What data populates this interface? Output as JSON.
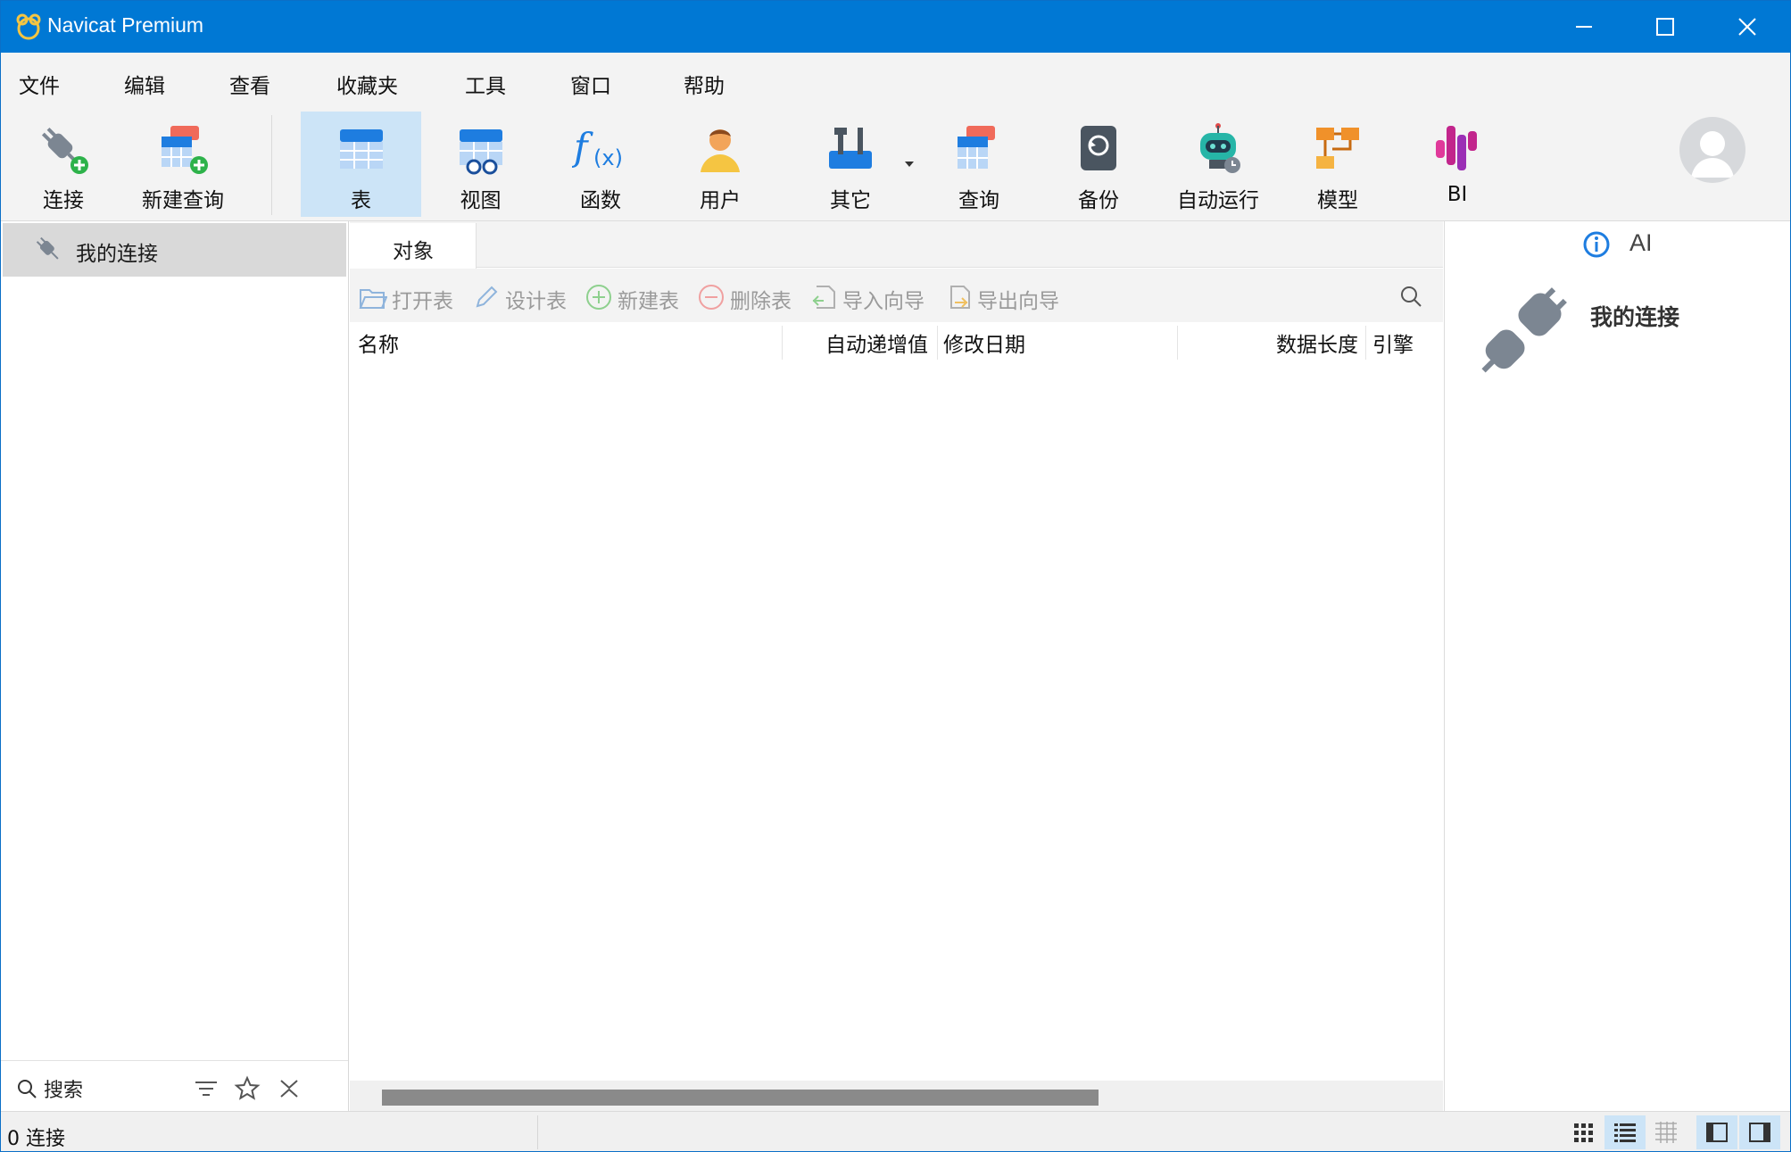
{
  "window": {
    "title": "Navicat Premium"
  },
  "menu": {
    "items": [
      "文件",
      "编辑",
      "查看",
      "收藏夹",
      "工具",
      "窗口",
      "帮助"
    ]
  },
  "toolbar": {
    "items": [
      {
        "label": "连接",
        "icon": "plug-add-icon"
      },
      {
        "label": "新建查询",
        "icon": "new-query-icon"
      },
      {
        "label": "表",
        "icon": "table-icon",
        "active": true
      },
      {
        "label": "视图",
        "icon": "view-icon"
      },
      {
        "label": "函数",
        "icon": "function-icon"
      },
      {
        "label": "用户",
        "icon": "user-icon"
      },
      {
        "label": "其它",
        "icon": "tools-icon"
      },
      {
        "label": "查询",
        "icon": "query-icon"
      },
      {
        "label": "备份",
        "icon": "backup-icon"
      },
      {
        "label": "自动运行",
        "icon": "robot-icon"
      },
      {
        "label": "模型",
        "icon": "model-icon"
      },
      {
        "label": "BI",
        "icon": "bi-icon"
      }
    ]
  },
  "left_panel": {
    "connection": "我的连接",
    "search_label": "搜索"
  },
  "center": {
    "tab": "对象",
    "actions": [
      "打开表",
      "设计表",
      "新建表",
      "删除表",
      "导入向导",
      "导出向导"
    ],
    "columns": [
      "名称",
      "自动递增值",
      "修改日期",
      "数据长度",
      "引擎"
    ]
  },
  "right_panel": {
    "ai_label": "AI",
    "connection_name": "我的连接"
  },
  "status": {
    "text": "0 连接"
  },
  "colors": {
    "titlebar": "#0078d4",
    "active_tool": "#cce4f7",
    "toolbar_bg": "#f3f3f3"
  }
}
